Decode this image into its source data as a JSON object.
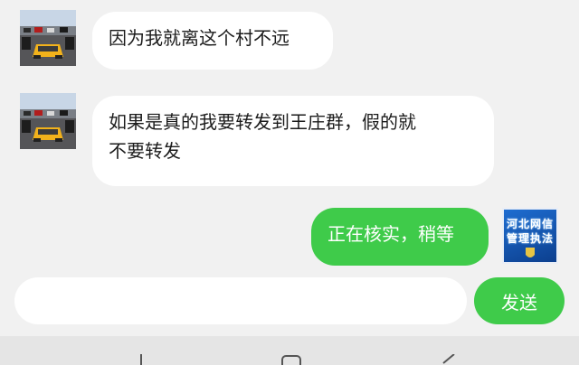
{
  "messages": [
    {
      "side": "incoming",
      "avatar": "car-photo-avatar",
      "text": "因为我就离这个村不远"
    },
    {
      "side": "incoming",
      "avatar": "car-photo-avatar",
      "text_line1": "如果是真的我要转发到王庄群，假的就",
      "text_line2": "不要转发"
    },
    {
      "side": "outgoing",
      "avatar_text_line1": "河北网信",
      "avatar_text_line2": "管理执法",
      "text": "正在核实，稍等"
    }
  ],
  "composer": {
    "input_value": "",
    "send_label": "发送"
  },
  "colors": {
    "outgoing_bubble": "#3fcb4a",
    "incoming_bubble": "#ffffff",
    "background": "#f1f1f1"
  },
  "navbar": {
    "icons": [
      "back-icon",
      "home-icon",
      "recents-icon"
    ]
  }
}
